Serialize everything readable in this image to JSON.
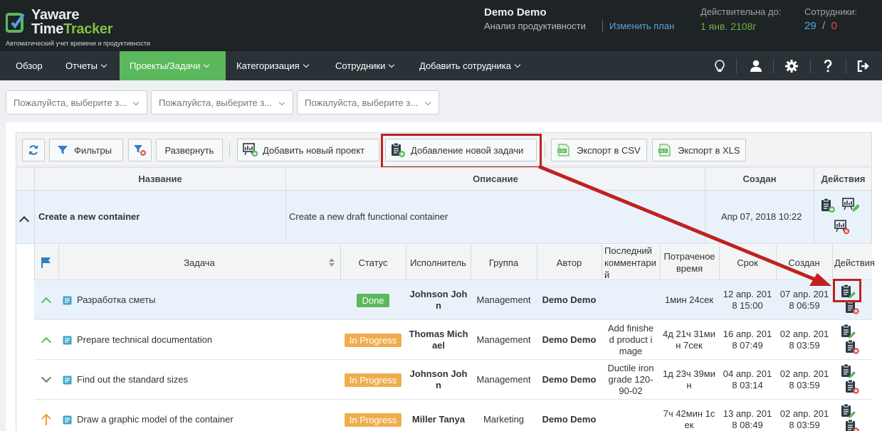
{
  "app": {
    "logo_line1": "Yaware",
    "logo_line2a": "Time",
    "logo_line2b": "Tracker",
    "subtitle": "Автоматический учет времени и продуктивности"
  },
  "header": {
    "user_name": "Demo Demo",
    "analysis_label": "Анализ продуктивности",
    "change_plan": "Изменить план",
    "valid_until_label": "Действительна до:",
    "valid_until_value": "1 янв. 2108г",
    "employees_label": "Сотрудники:",
    "employees_active": "29",
    "employees_sep": "/",
    "employees_other": "0"
  },
  "nav": {
    "items": [
      {
        "label": "Обзор"
      },
      {
        "label": "Отчеты"
      },
      {
        "label": "Проекты/Задачи"
      },
      {
        "label": "Категоризация"
      },
      {
        "label": "Сотрудники"
      },
      {
        "label": "Добавить сотрудника"
      }
    ],
    "icons": [
      "lightbulb-icon",
      "user-icon",
      "gear-icon",
      "help-icon",
      "logout-icon"
    ]
  },
  "filters": {
    "placeholder1": "Пожалуйста, выберите з...",
    "placeholder2": "Пожалуйста, выберите з...",
    "placeholder3": "Пожалуйста, выберите з..."
  },
  "toolbar": {
    "filters": "Фильтры",
    "expand": "Развернуть",
    "add_project": "Добавить новый проект",
    "add_task": "Добавление новой задачи",
    "export_csv": "Экспорт в CSV",
    "export_xls": "Экспорт в XLS"
  },
  "projects_table": {
    "headers": {
      "name": "Название",
      "description": "Описание",
      "created": "Создан",
      "actions": "Действия"
    },
    "project": {
      "name": "Create a new container",
      "description": "Create a new draft functional container",
      "created": "Апр 07, 2018 10:22"
    }
  },
  "tasks_table": {
    "headers": {
      "task": "Задача",
      "status": "Статус",
      "assignee": "Исполнитель",
      "group": "Группа",
      "author": "Автор",
      "last_comment": "Последний комментарий",
      "time_spent": "Потраченое время",
      "deadline": "Срок",
      "created": "Создан",
      "actions": "Действия"
    },
    "rows": [
      {
        "priority": "up",
        "task": "Разработка сметы",
        "status": "Done",
        "assignee": "Johnson John",
        "group": "Management",
        "author": "Demo Demo",
        "comment": "",
        "time": "1мин 24сек",
        "deadline": "12 апр. 2018 15:00",
        "created": "07 апр. 2018 06:59"
      },
      {
        "priority": "up",
        "task": "Prepare technical documentation",
        "status": "In Progress",
        "assignee": "Thomas Michael",
        "group": "Management",
        "author": "Demo Demo",
        "comment": "Add finished product image",
        "time": "4д 21ч 31мин 7сек",
        "deadline": "16 апр. 2018 07:49",
        "created": "02 апр. 2018 03:59"
      },
      {
        "priority": "down",
        "task": "Find out the standard sizes",
        "status": "In Progress",
        "assignee": "Johnson John",
        "group": "Management",
        "author": "Demo Demo",
        "comment": "Ductile iron grade 120-90-02",
        "time": "1д 23ч 39мин",
        "deadline": "04 апр. 2018 03:14",
        "created": "02 апр. 2018 03:59"
      },
      {
        "priority": "high",
        "task": "Draw a graphic model of the container",
        "status": "In Progress",
        "assignee": "Miller Tanya",
        "group": "Marketing",
        "author": "Demo Demo",
        "comment": "",
        "time": "7ч 42мин 1сек",
        "deadline": "13 апр. 2018 08:49",
        "created": "02 апр. 2018 03:59"
      }
    ]
  },
  "colors": {
    "accent_green": "#5cb85c",
    "highlight_red": "#c0211f",
    "link_blue": "#5aa3d8"
  }
}
